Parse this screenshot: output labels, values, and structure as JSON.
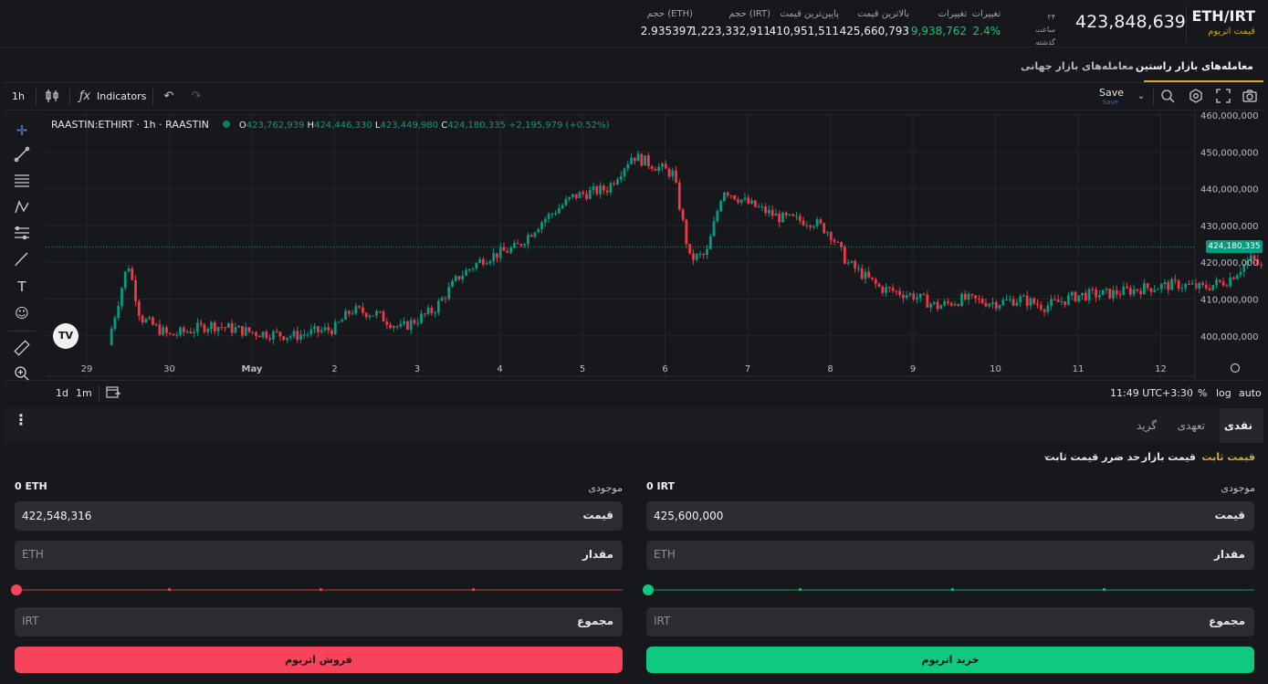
{
  "header": {
    "pair": "ETH/IRT",
    "pair_name": "قیمت اتریوم",
    "last_price": "423,848,639",
    "period_line1": "۲۴ ساعت",
    "period_line2": "گذشته",
    "stats": [
      {
        "label": "تغییرات",
        "value": "2.4%",
        "positive": true
      },
      {
        "label": "تغییرات",
        "value": "9,938,762",
        "positive": true
      },
      {
        "label": "بالاترین قیمت",
        "value": "425,660,793",
        "positive": false
      },
      {
        "label": "پایین‌ترین قیمت",
        "value": "410,951,511",
        "positive": false
      },
      {
        "label": "حجم (IRT)",
        "value": "1,223,332,911",
        "positive": false
      },
      {
        "label": "حجم (ETH)",
        "value": "2.935397",
        "positive": false
      }
    ]
  },
  "market_tabs": {
    "raastin": "معامله‌های بازار راستین",
    "global": "معامله‌های بازار جهانی"
  },
  "toolbar": {
    "interval": "1h",
    "indicators": "Indicators",
    "save": "Save",
    "save_sub": "Save"
  },
  "legend": {
    "symbol": "RAASTIN:ETHIRT · 1h · RAASTIN",
    "o_label": "O",
    "o": "423,762,939",
    "h_label": "H",
    "h": "424,446,330",
    "l_label": "L",
    "l": "423,449,980",
    "c_label": "C",
    "c": "424,180,335",
    "change": "+2,195,979 (+0.52%)"
  },
  "chart_bottom": {
    "r1": "1d",
    "r2": "1m",
    "time": "11:49 UTC+3:30",
    "pct": "%",
    "log": "log",
    "auto": "auto"
  },
  "chart_data": {
    "type": "candlestick",
    "x_ticks": [
      "29",
      "30",
      "May",
      "2",
      "3",
      "4",
      "5",
      "6",
      "7",
      "8",
      "9",
      "10",
      "11",
      "12"
    ],
    "y_ticks": [
      "400,000,000",
      "410,000,000",
      "420,000,000",
      "430,000,000",
      "440,000,000",
      "450,000,000",
      "460,000,000"
    ],
    "y_tick_values": [
      400000000,
      410000000,
      420000000,
      430000000,
      440000000,
      450000000,
      460000000
    ],
    "ylim": [
      393500000,
      460500000
    ],
    "last_label": "424,180,335",
    "last_value": 424180335,
    "up_color": "#089981",
    "down_color": "#f23645",
    "path_points": [
      [
        0,
        397500000
      ],
      [
        0.3,
        402000000
      ],
      [
        0.5,
        420000000
      ],
      [
        0.65,
        405000000
      ],
      [
        1.0,
        400000000
      ],
      [
        1.5,
        403000000
      ],
      [
        2.0,
        401000000
      ],
      [
        2.5,
        400000000
      ],
      [
        3.0,
        402000000
      ],
      [
        3.2,
        407000000
      ],
      [
        3.5,
        406000000
      ],
      [
        3.8,
        402000000
      ],
      [
        4.2,
        407000000
      ],
      [
        4.5,
        416000000
      ],
      [
        4.8,
        421000000
      ],
      [
        5.2,
        424000000
      ],
      [
        5.5,
        431000000
      ],
      [
        5.9,
        438000000
      ],
      [
        6.3,
        440000000
      ],
      [
        6.6,
        449000000
      ],
      [
        6.8,
        447000000
      ],
      [
        7.1,
        444000000
      ],
      [
        7.3,
        421000000
      ],
      [
        7.5,
        422000000
      ],
      [
        7.7,
        440000000
      ],
      [
        8.0,
        436000000
      ],
      [
        8.4,
        432000000
      ],
      [
        8.8,
        431000000
      ],
      [
        9.0,
        428000000
      ],
      [
        9.2,
        420000000
      ],
      [
        9.6,
        413000000
      ],
      [
        10.0,
        411000000
      ],
      [
        10.3,
        408000000
      ],
      [
        10.6,
        410000000
      ],
      [
        11.0,
        409000000
      ],
      [
        11.3,
        410000000
      ],
      [
        11.6,
        408000000
      ],
      [
        12.0,
        411000000
      ],
      [
        12.4,
        411500000
      ],
      [
        12.8,
        413000000
      ],
      [
        13.2,
        414000000
      ],
      [
        13.5,
        413000000
      ],
      [
        13.8,
        415000000
      ],
      [
        14.1,
        421000000
      ],
      [
        14.3,
        417000000
      ],
      [
        14.5,
        418000000
      ],
      [
        14.7,
        421000000
      ],
      [
        14.75,
        424180335
      ]
    ]
  },
  "order_tabs": {
    "spot": "نقدی",
    "committed": "تعهدی",
    "grid": "گرید"
  },
  "order_types": {
    "fixed": "قیمت ثابت",
    "market": "قیمت بازار",
    "stop": "حد ضرر قیمت ثابت"
  },
  "buy": {
    "balance_label": "موجودی",
    "balance": "0 IRT",
    "price_label": "قیمت",
    "price": "425,600,000",
    "amount_label": "مقدار",
    "amount_placeholder": "ETH",
    "total_label": "مجموع",
    "total_placeholder": "IRT",
    "button": "خرید اتریوم",
    "color": "#10c980"
  },
  "sell": {
    "balance_label": "موجودی",
    "balance": "0 ETH",
    "price_label": "قیمت",
    "price": "422,548,316",
    "amount_label": "مقدار",
    "amount_placeholder": "ETH",
    "total_label": "مجموع",
    "total_placeholder": "IRT",
    "button": "فروش اتریوم",
    "color": "#f7435b"
  }
}
